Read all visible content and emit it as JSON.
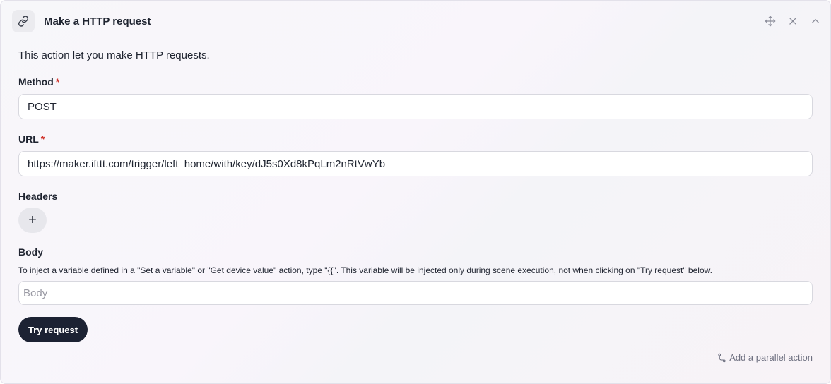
{
  "panel": {
    "title": "Make a HTTP request",
    "description": "This action let you make HTTP requests.",
    "icons": {
      "header": "link-icon",
      "move": "move-icon",
      "close": "close-icon",
      "collapse": "chevron-up-icon",
      "add_header": "plus-icon",
      "parallel": "branch-icon"
    }
  },
  "method": {
    "label": "Method",
    "required_mark": "*",
    "value": "POST"
  },
  "url": {
    "label": "URL",
    "required_mark": "*",
    "value": "https://maker.ifttt.com/trigger/left_home/with/key/dJ5s0Xd8kPqLm2nRtVwYb"
  },
  "headers": {
    "label": "Headers",
    "add_label": "+"
  },
  "body": {
    "label": "Body",
    "hint": "To inject a variable defined in a \"Set a variable\" or \"Get device value\" action, type \"{{\". This variable will be injected only during scene execution, not when clicking on \"Try request\" below.",
    "placeholder": "Body",
    "value": ""
  },
  "actions": {
    "try_request": "Try request",
    "add_parallel": "Add a parallel action"
  },
  "colors": {
    "required": "#d0342c",
    "primary_button": "#1c2233",
    "muted_text": "#6e7080"
  }
}
